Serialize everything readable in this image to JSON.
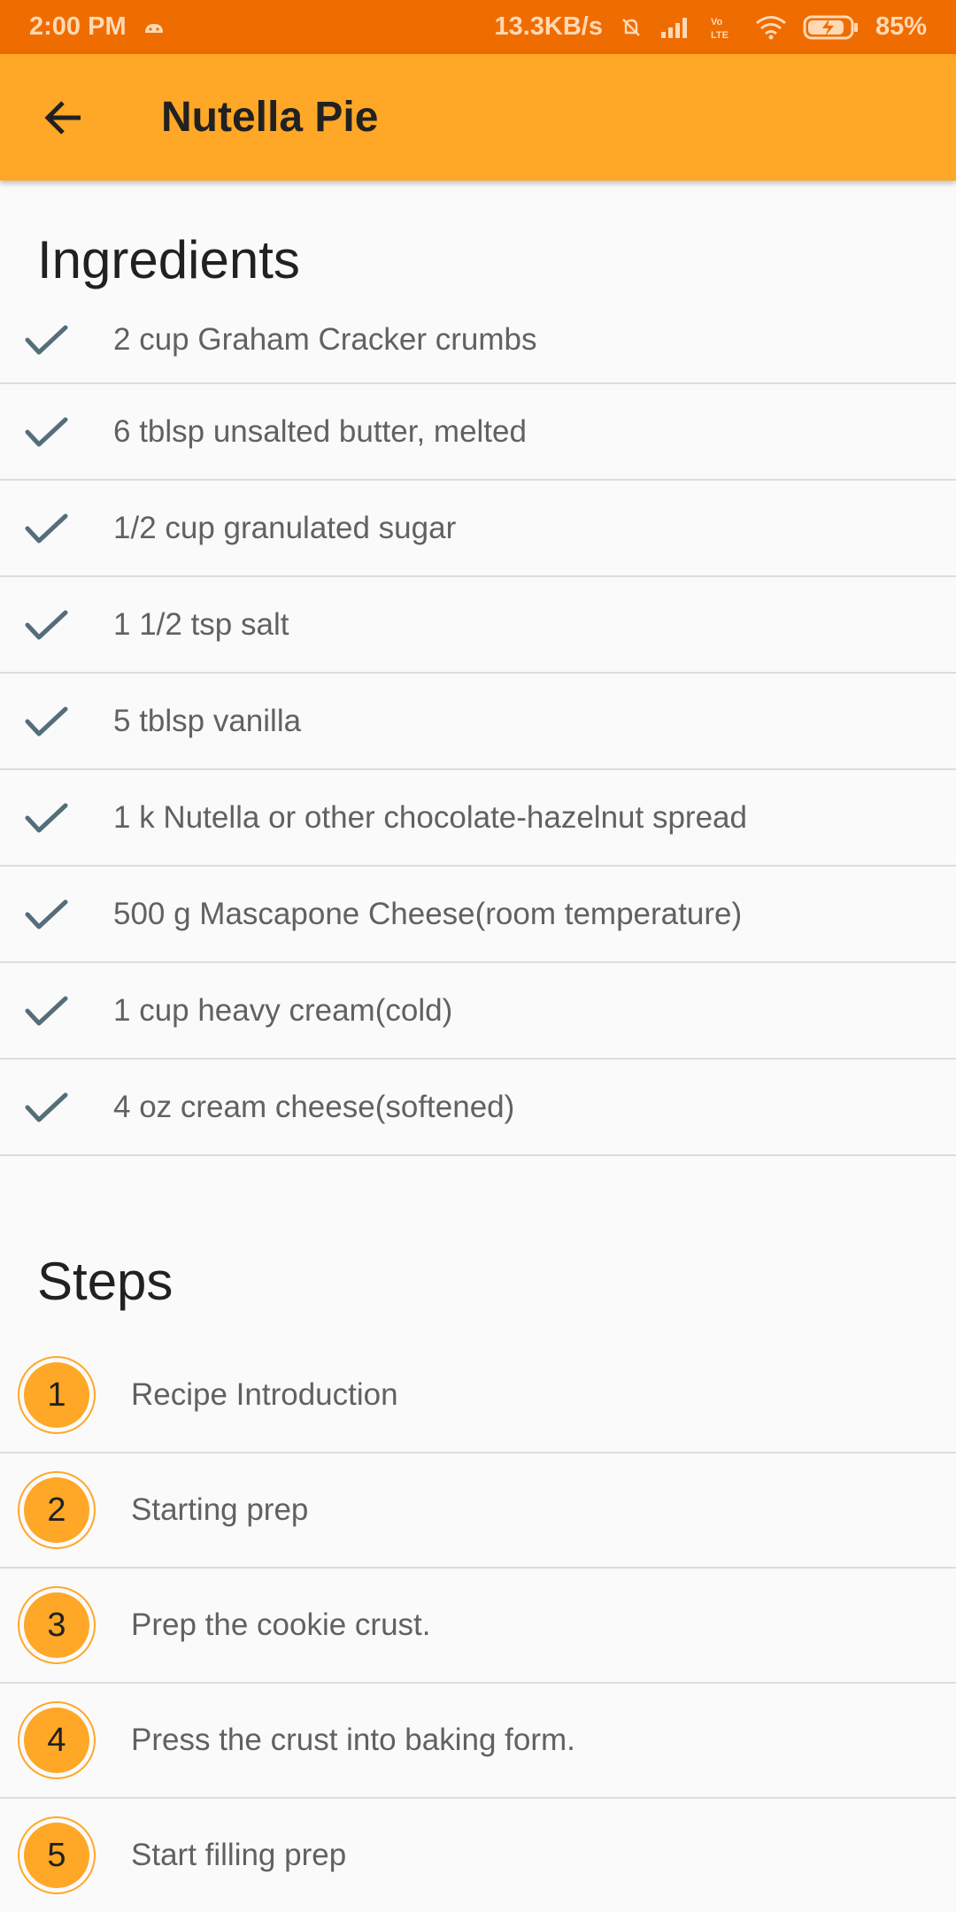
{
  "status_bar": {
    "time": "2:00 PM",
    "network_speed": "13.3KB/s",
    "battery_percent": "85%",
    "icons": [
      "android-icon",
      "mute-icon",
      "signal-icon",
      "volte-icon",
      "wifi-icon",
      "battery-charging-icon"
    ]
  },
  "app_bar": {
    "title": "Nutella Pie",
    "back_icon": "arrow-back-icon"
  },
  "ingredients": {
    "title": "Ingredients",
    "items": [
      {
        "text": "2  cup Graham Cracker crumbs"
      },
      {
        "text": "6  tblsp unsalted butter, melted"
      },
      {
        "text": "1/2 cup granulated sugar"
      },
      {
        "text": "1 1/2 tsp salt"
      },
      {
        "text": "5  tblsp vanilla"
      },
      {
        "text": "1  k Nutella or other chocolate-hazelnut spread"
      },
      {
        "text": "500  g Mascapone Cheese(room temperature)"
      },
      {
        "text": "1  cup heavy cream(cold)"
      },
      {
        "text": "4  oz cream cheese(softened)"
      }
    ]
  },
  "steps": {
    "title": "Steps",
    "items": [
      {
        "number": "1",
        "text": "Recipe Introduction"
      },
      {
        "number": "2",
        "text": "Starting prep"
      },
      {
        "number": "3",
        "text": "Prep the cookie crust."
      },
      {
        "number": "4",
        "text": "Press the crust into baking form."
      },
      {
        "number": "5",
        "text": "Start filling prep"
      }
    ]
  },
  "colors": {
    "status_bar": "#ef6c00",
    "app_bar": "#ffa726",
    "accent": "#ffa726",
    "check": "#546e7a"
  }
}
